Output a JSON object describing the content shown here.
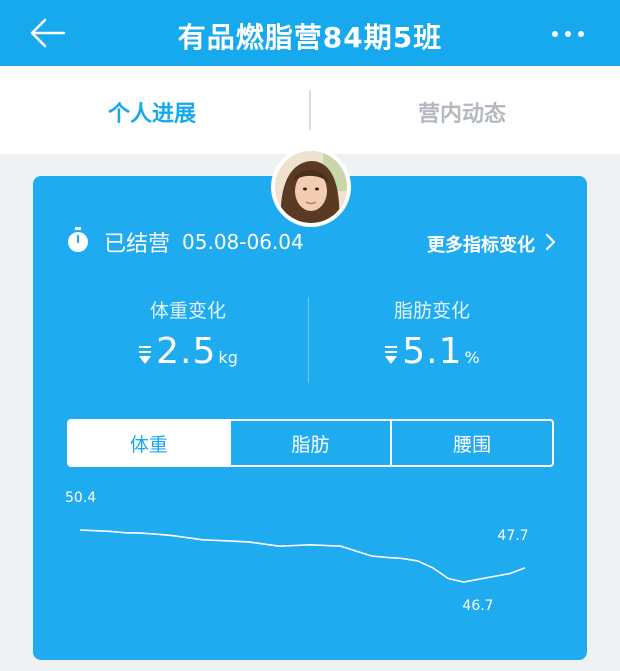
{
  "header": {
    "title": "有品燃脂营84期5班",
    "back_icon": "arrow-left-icon",
    "more_icon": "more-dots-icon"
  },
  "tabs": [
    {
      "label": "个人进展",
      "active": true
    },
    {
      "label": "营内动态",
      "active": false
    }
  ],
  "summary": {
    "status_label": "已结营",
    "date_range": "05.08-06.04",
    "more_link": "更多指标变化",
    "weight_change": {
      "label": "体重变化",
      "value": "2.5",
      "unit": "kg"
    },
    "fat_change": {
      "label": "脂肪变化",
      "value": "5.1",
      "unit": "%"
    }
  },
  "segments": [
    {
      "label": "体重",
      "selected": true
    },
    {
      "label": "脂肪",
      "selected": false
    },
    {
      "label": "腰围",
      "selected": false
    }
  ],
  "colors": {
    "brand": "#16a9ee",
    "card": "#1fabf0"
  },
  "chart_data": {
    "type": "line",
    "series": [
      {
        "values": [
          50.4,
          50.35,
          50.3,
          50.2,
          50.18,
          50.1,
          50.0,
          49.85,
          49.7,
          49.65,
          49.6,
          49.55,
          49.4,
          49.25,
          49.3,
          49.35,
          49.3,
          49.25,
          48.9,
          48.55,
          48.45,
          48.38,
          48.2,
          47.7,
          46.95,
          46.7,
          46.9,
          47.1,
          47.3,
          47.7
        ]
      }
    ],
    "annotations": [
      {
        "text": "50.4",
        "value": 50.4
      },
      {
        "text": "47.7",
        "value": 47.7
      },
      {
        "text": "46.7",
        "value": 46.7
      }
    ]
  }
}
